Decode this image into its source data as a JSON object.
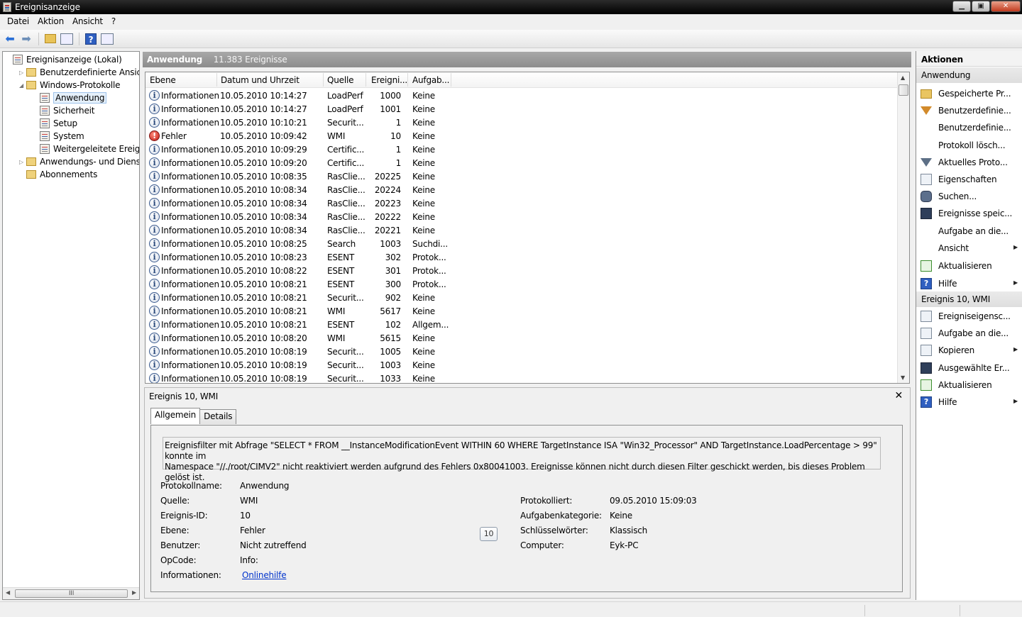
{
  "window": {
    "title": "Ereignisanzeige"
  },
  "menu": [
    "Datei",
    "Aktion",
    "Ansicht",
    "?"
  ],
  "tree": [
    {
      "label": "Ereignisanzeige (Lokal)",
      "toggle": "",
      "icon": "log",
      "indent": 0
    },
    {
      "label": "Benutzerdefinierte Ansichten",
      "toggle": "▷",
      "icon": "folder",
      "indent": 1
    },
    {
      "label": "Windows-Protokolle",
      "toggle": "◢",
      "icon": "folder",
      "indent": 1
    },
    {
      "label": "Anwendung",
      "toggle": "",
      "icon": "log",
      "indent": 2,
      "selected": true
    },
    {
      "label": "Sicherheit",
      "toggle": "",
      "icon": "log",
      "indent": 2
    },
    {
      "label": "Setup",
      "toggle": "",
      "icon": "log",
      "indent": 2
    },
    {
      "label": "System",
      "toggle": "",
      "icon": "log",
      "indent": 2
    },
    {
      "label": "Weitergeleitete Ereignisse",
      "toggle": "",
      "icon": "log",
      "indent": 2
    },
    {
      "label": "Anwendungs- und Dienstprotokolle",
      "toggle": "▷",
      "icon": "folder",
      "indent": 1
    },
    {
      "label": "Abonnements",
      "toggle": "",
      "icon": "folder",
      "indent": 1
    }
  ],
  "tree_scroll_glyph": "III",
  "center": {
    "title": "Anwendung",
    "count": "11.383 Ereignisse"
  },
  "columns": [
    "Ebene",
    "Datum und Uhrzeit",
    "Quelle",
    "Ereigni...",
    "Aufgab..."
  ],
  "events": [
    {
      "level": "Informationen",
      "icon": "info",
      "date": "10.05.2010 10:14:27",
      "source": "LoadPerf",
      "id": "1000",
      "task": "Keine"
    },
    {
      "level": "Informationen",
      "icon": "info",
      "date": "10.05.2010 10:14:27",
      "source": "LoadPerf",
      "id": "1001",
      "task": "Keine"
    },
    {
      "level": "Informationen",
      "icon": "info",
      "date": "10.05.2010 10:10:21",
      "source": "Securit...",
      "id": "1",
      "task": "Keine"
    },
    {
      "level": "Fehler",
      "icon": "error",
      "date": "10.05.2010 10:09:42",
      "source": "WMI",
      "id": "10",
      "task": "Keine"
    },
    {
      "level": "Informationen",
      "icon": "info",
      "date": "10.05.2010 10:09:29",
      "source": "Certific...",
      "id": "1",
      "task": "Keine"
    },
    {
      "level": "Informationen",
      "icon": "info",
      "date": "10.05.2010 10:09:20",
      "source": "Certific...",
      "id": "1",
      "task": "Keine"
    },
    {
      "level": "Informationen",
      "icon": "info",
      "date": "10.05.2010 10:08:35",
      "source": "RasClie...",
      "id": "20225",
      "task": "Keine"
    },
    {
      "level": "Informationen",
      "icon": "info",
      "date": "10.05.2010 10:08:34",
      "source": "RasClie...",
      "id": "20224",
      "task": "Keine"
    },
    {
      "level": "Informationen",
      "icon": "info",
      "date": "10.05.2010 10:08:34",
      "source": "RasClie...",
      "id": "20223",
      "task": "Keine"
    },
    {
      "level": "Informationen",
      "icon": "info",
      "date": "10.05.2010 10:08:34",
      "source": "RasClie...",
      "id": "20222",
      "task": "Keine"
    },
    {
      "level": "Informationen",
      "icon": "info",
      "date": "10.05.2010 10:08:34",
      "source": "RasClie...",
      "id": "20221",
      "task": "Keine"
    },
    {
      "level": "Informationen",
      "icon": "info",
      "date": "10.05.2010 10:08:25",
      "source": "Search",
      "id": "1003",
      "task": "Suchdi..."
    },
    {
      "level": "Informationen",
      "icon": "info",
      "date": "10.05.2010 10:08:23",
      "source": "ESENT",
      "id": "302",
      "task": "Protok..."
    },
    {
      "level": "Informationen",
      "icon": "info",
      "date": "10.05.2010 10:08:22",
      "source": "ESENT",
      "id": "301",
      "task": "Protok..."
    },
    {
      "level": "Informationen",
      "icon": "info",
      "date": "10.05.2010 10:08:21",
      "source": "ESENT",
      "id": "300",
      "task": "Protok..."
    },
    {
      "level": "Informationen",
      "icon": "info",
      "date": "10.05.2010 10:08:21",
      "source": "Securit...",
      "id": "902",
      "task": "Keine"
    },
    {
      "level": "Informationen",
      "icon": "info",
      "date": "10.05.2010 10:08:21",
      "source": "WMI",
      "id": "5617",
      "task": "Keine"
    },
    {
      "level": "Informationen",
      "icon": "info",
      "date": "10.05.2010 10:08:21",
      "source": "ESENT",
      "id": "102",
      "task": "Allgem..."
    },
    {
      "level": "Informationen",
      "icon": "info",
      "date": "10.05.2010 10:08:20",
      "source": "WMI",
      "id": "5615",
      "task": "Keine"
    },
    {
      "level": "Informationen",
      "icon": "info",
      "date": "10.05.2010 10:08:19",
      "source": "Securit...",
      "id": "1005",
      "task": "Keine"
    },
    {
      "level": "Informationen",
      "icon": "info",
      "date": "10.05.2010 10:08:19",
      "source": "Securit...",
      "id": "1003",
      "task": "Keine"
    },
    {
      "level": "Informationen",
      "icon": "info",
      "date": "10.05.2010 10:08:19",
      "source": "Securit...",
      "id": "1033",
      "task": "Keine"
    }
  ],
  "detail": {
    "title": "Ereignis 10, WMI",
    "close": "✕",
    "tabs": [
      "Allgemein",
      "Details"
    ],
    "description_line1": "Ereignisfilter mit Abfrage \"SELECT * FROM __InstanceModificationEvent WITHIN 60 WHERE TargetInstance ISA \"Win32_Processor\" AND TargetInstance.LoadPercentage > 99\" konnte im",
    "description_line2": "Namespace \"//./root/CIMV2\" nicht reaktiviert werden aufgrund des Fehlers 0x80041003. Ereignisse können nicht durch diesen Filter geschickt werden, bis dieses Problem gelöst ist.",
    "left": [
      {
        "key": "Protokollname:",
        "value": "Anwendung"
      },
      {
        "key": "Quelle:",
        "value": "WMI"
      },
      {
        "key": "Ereignis-ID:",
        "value": "10"
      },
      {
        "key": "Ebene:",
        "value": "Fehler"
      },
      {
        "key": "Benutzer:",
        "value": "Nicht zutreffend"
      },
      {
        "key": "OpCode:",
        "value": "Info:"
      },
      {
        "key": "Informationen:",
        "value": "Onlinehilfe",
        "link": true
      }
    ],
    "right": [
      {
        "key": "Protokolliert:",
        "value": "09.05.2010 15:09:03"
      },
      {
        "key": "Aufgabenkategorie:",
        "value": "Keine"
      },
      {
        "key": "Schlüsselwörter:",
        "value": "Klassisch"
      },
      {
        "key": "Computer:",
        "value": "Eyk-PC"
      }
    ],
    "badge": "10"
  },
  "actions": {
    "title": "Aktionen",
    "section1": "Anwendung",
    "items1": [
      {
        "label": "Gespeicherte Pr...",
        "icon": "folder-open-icon",
        "cls": "folder",
        "sub": false
      },
      {
        "label": "Benutzerdefinie...",
        "icon": "filter-icon",
        "cls": "funnel orange",
        "sub": false
      },
      {
        "label": "Benutzerdefinie...",
        "icon": "blank-icon",
        "cls": "none",
        "sub": false
      },
      {
        "label": "Protokoll lösch...",
        "icon": "blank-icon",
        "cls": "none",
        "sub": false
      },
      {
        "label": "Aktuelles Proto...",
        "icon": "filter-icon",
        "cls": "funnel",
        "sub": false
      },
      {
        "label": "Eigenschaften",
        "icon": "properties-icon",
        "cls": "",
        "sub": false
      },
      {
        "label": "Suchen...",
        "icon": "binoculars-icon",
        "cls": "bino",
        "sub": false
      },
      {
        "label": "Ereignisse speic...",
        "icon": "save-icon",
        "cls": "disk",
        "sub": false
      },
      {
        "label": "Aufgabe an die...",
        "icon": "blank-icon",
        "cls": "none",
        "sub": false
      },
      {
        "label": "Ansicht",
        "icon": "blank-icon",
        "cls": "none",
        "sub": true
      },
      {
        "label": "Aktualisieren",
        "icon": "refresh-icon",
        "cls": "green",
        "sub": false
      },
      {
        "label": "Hilfe",
        "icon": "help-icon",
        "cls": "help",
        "sub": true
      }
    ],
    "section2": "Ereignis 10, WMI",
    "items2": [
      {
        "label": "Ereigniseigensc...",
        "icon": "properties-icon",
        "cls": "",
        "sub": false
      },
      {
        "label": "Aufgabe an die...",
        "icon": "task-icon",
        "cls": "",
        "sub": false
      },
      {
        "label": "Kopieren",
        "icon": "copy-icon",
        "cls": "",
        "sub": true
      },
      {
        "label": "Ausgewählte Er...",
        "icon": "save-icon",
        "cls": "disk",
        "sub": false
      },
      {
        "label": "Aktualisieren",
        "icon": "refresh-icon",
        "cls": "green",
        "sub": false
      },
      {
        "label": "Hilfe",
        "icon": "help-icon",
        "cls": "help",
        "sub": true
      }
    ]
  }
}
